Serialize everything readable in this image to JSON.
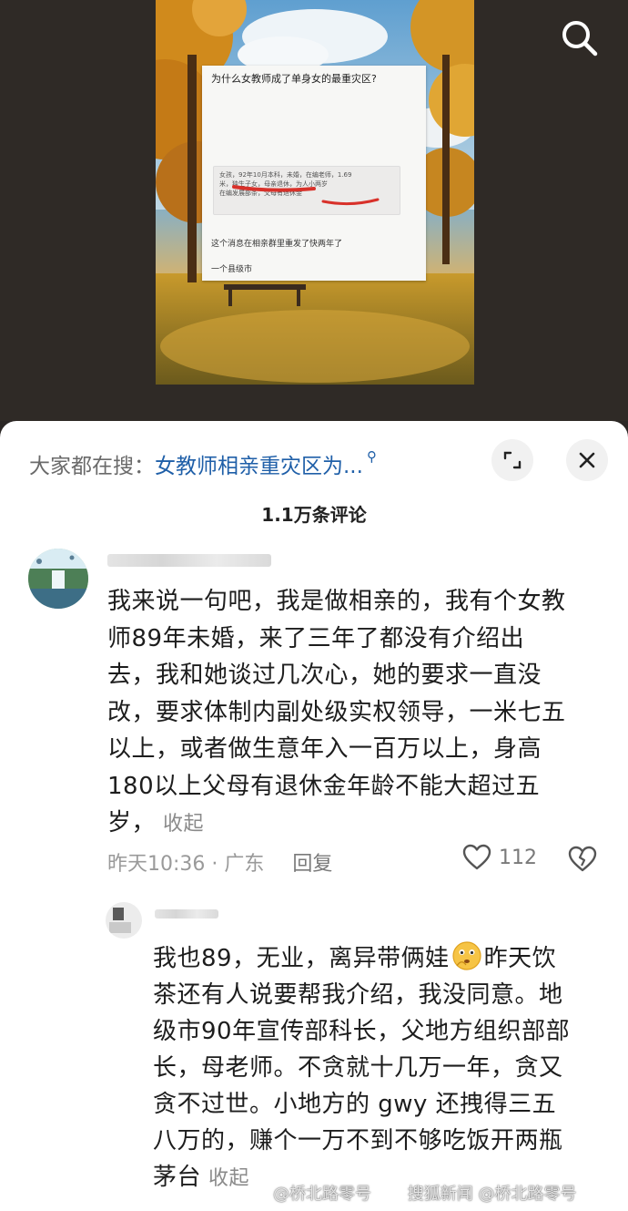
{
  "video": {
    "embedded_post": {
      "title": "为什么女教师成了单身女的最重灾区?",
      "quote_lines": [
        "女孩，92年10月本科，未婚，在编老师，1.69",
        "米，独生子女，母亲退休，为人小两岁",
        "在编发展部条，父母有退休金"
      ],
      "note": "这个消息在相亲群里重发了快两年了",
      "city": "一个县级市"
    },
    "search_icon": "search-icon"
  },
  "sheet": {
    "hot_search_prefix": "大家都在搜：",
    "hot_search_query": "女教师相亲重灾区为...",
    "hot_search_icon": "search-icon",
    "expand_icon": "expand-icon",
    "close_icon": "close-icon",
    "comment_count": "1.1万条评论"
  },
  "comments": [
    {
      "lines": [
        "我来说一句吧，我是做相亲的，我有个女教",
        "师89年未婚，来了三年了都没有介绍出",
        "去，我和她谈过几次心，她的要求一直没",
        "改，要求体制内副处级实权领导，一米七五",
        "以上，或者做生意年入一百万以上，身高",
        "180以上父母有退休金年龄不能大超过五",
        "岁，"
      ],
      "collapse_label": "收起",
      "time": "昨天10:36",
      "dot": "·",
      "location": "广东",
      "reply_label": "回复",
      "likes": "112"
    },
    {
      "line1_a": "我也89，无业，离异带俩娃",
      "line1_b": "昨天饮",
      "lines": [
        "茶还有人说要帮我介绍，我没同意。地",
        "级市90年宣传部科长，父地方组织部部",
        "长，母老师。不贪就十几万一年，贪又",
        "贪不过世。小地方的 gwy 还拽得三五",
        "八万的，赚个一万不到不够吃饭开两瓶"
      ],
      "last_line": "茅台",
      "collapse_label": "收起",
      "emoji": "thinking-emoji"
    }
  ],
  "watermark": {
    "weibo": "@桥北路零号",
    "sohu": "搜狐新闻 @桥北路零号"
  }
}
